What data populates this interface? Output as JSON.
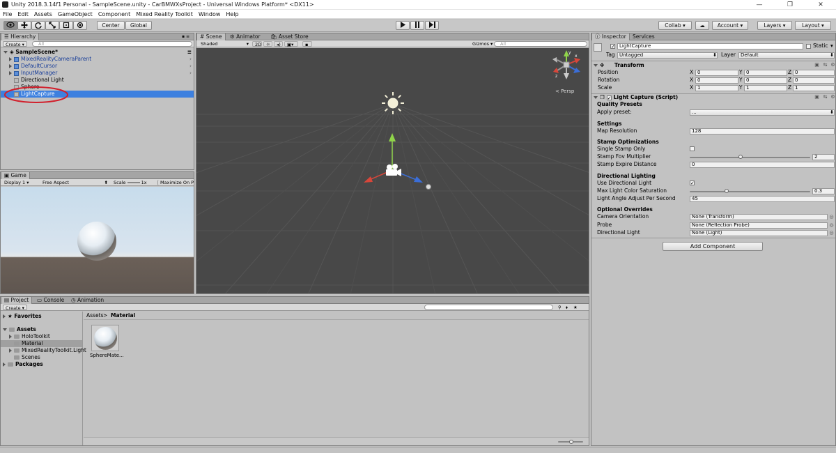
{
  "window": {
    "title": "Unity 2018.3.14f1 Personal - SampleScene.unity - CarBMWXsProject - Universal Windows Platform* <DX11>",
    "minimize": "—",
    "restore": "❐",
    "close": "✕"
  },
  "menu": [
    "File",
    "Edit",
    "Assets",
    "GameObject",
    "Component",
    "Mixed Reality Toolkit",
    "Window",
    "Help"
  ],
  "toolbar": {
    "center": "Center",
    "global": "Global",
    "collab": "Collab",
    "account": "Account",
    "layers": "Layers",
    "layout": "Layout"
  },
  "hierarchy": {
    "tab": "Hierarchy",
    "create": "Create",
    "search": "All",
    "scene": "SampleScene*",
    "items": [
      {
        "label": "MixedRealityCameraParent",
        "prefab": true,
        "arrow": true
      },
      {
        "label": "DefaultCursor",
        "prefab": true,
        "arrow": true
      },
      {
        "label": "InputManager",
        "prefab": true,
        "arrow": true
      },
      {
        "label": "Directional Light",
        "prefab": false,
        "arrow": false
      },
      {
        "label": "Sphere",
        "prefab": false,
        "arrow": false
      },
      {
        "label": "LightCapture",
        "prefab": false,
        "arrow": false,
        "selected": true
      }
    ]
  },
  "game": {
    "tab": "Game",
    "display": "Display 1",
    "aspect": "Free Aspect",
    "scale_label": "Scale",
    "scale_value": "1x",
    "maximize": "Maximize On Pla"
  },
  "scene": {
    "tab": "Scene",
    "tab2": "Animator",
    "tab3": "Asset Store",
    "shading": "Shaded",
    "mode2d": "2D",
    "gizmos": "Gizmos",
    "search": "All",
    "persp": "< Persp",
    "axis_y": "y",
    "axis_x": "x",
    "axis_z": "z"
  },
  "project": {
    "tabs": [
      "Project",
      "Console",
      "Animation"
    ],
    "create": "Create",
    "favorites": "Favorites",
    "assets": "Assets",
    "folders": [
      "HoloToolkit",
      "Material",
      "MixedRealityToolkit.Light",
      "Scenes"
    ],
    "packages": "Packages",
    "breadcrumb_root": "Assets",
    "breadcrumb_sep": ">",
    "breadcrumb_current": "Material",
    "asset_name": "SphereMate..."
  },
  "inspector": {
    "tab": "Inspector",
    "tab2": "Services",
    "object_name": "LightCapture",
    "static_label": "Static",
    "tag_label": "Tag",
    "tag_value": "Untagged",
    "layer_label": "Layer",
    "layer_value": "Default",
    "transform": {
      "title": "Transform",
      "rows": [
        {
          "label": "Position",
          "x": "0",
          "y": "0",
          "z": "0"
        },
        {
          "label": "Rotation",
          "x": "0",
          "y": "0",
          "z": "0"
        },
        {
          "label": "Scale",
          "x": "1",
          "y": "1",
          "z": "1"
        }
      ]
    },
    "script": {
      "title": "Light Capture (Script)",
      "quality_header": "Quality Presets",
      "apply_preset_label": "Apply preset:",
      "apply_preset_value": "...",
      "settings_header": "Settings",
      "map_res_label": "Map Resolution",
      "map_res_value": "128",
      "stamp_header": "Stamp Optimizations",
      "single_stamp_label": "Single Stamp Only",
      "single_stamp_checked": false,
      "fov_label": "Stamp Fov Multiplier",
      "fov_value": "2",
      "fov_level": 0.42,
      "expire_label": "Stamp Expire Distance",
      "expire_value": "0",
      "dir_header": "Directional Lighting",
      "use_dir_label": "Use Directional Light",
      "use_dir_checked": true,
      "sat_label": "Max Light Color Saturation",
      "sat_value": "0.3",
      "sat_level": 0.3,
      "angle_label": "Light Angle Adjust Per Second",
      "angle_value": "45",
      "overrides_header": "Optional Overrides",
      "cam_label": "Camera Orientation",
      "cam_value": "None (Transform)",
      "probe_label": "Probe",
      "probe_value": "None (Reflection Probe)",
      "dlight_label": "Directional Light",
      "dlight_value": "None (Light)"
    },
    "add_component": "Add Component"
  }
}
